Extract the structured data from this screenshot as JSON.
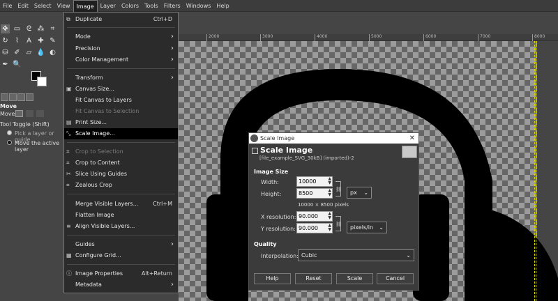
{
  "menubar": {
    "items": [
      "File",
      "Edit",
      "Select",
      "View",
      "Image",
      "Layer",
      "Colors",
      "Tools",
      "Filters",
      "Windows",
      "Help"
    ],
    "active": "Image"
  },
  "tool_options": {
    "title": "Move",
    "move_label": "Move:",
    "toggle_label": "Tool Toggle  (Shift)",
    "radio1": "Pick a layer or guide",
    "radio2": "Move the active layer"
  },
  "ruler": {
    "ticks": [
      "2000",
      "3000",
      "4000",
      "5000",
      "6000",
      "7000",
      "8000"
    ]
  },
  "image_menu": {
    "items": [
      {
        "label": "Duplicate",
        "shortcut": "Ctrl+D",
        "icon": "duplicate-icon"
      },
      {
        "label": "Mode",
        "submenu": true
      },
      {
        "label": "Precision",
        "submenu": true
      },
      {
        "label": "Color Management",
        "submenu": true
      },
      {
        "label": "Transform",
        "submenu": true
      },
      {
        "label": "Canvas Size...",
        "icon": "canvas-size-icon"
      },
      {
        "label": "Fit Canvas to Layers"
      },
      {
        "label": "Fit Canvas to Selection",
        "disabled": true
      },
      {
        "label": "Print Size...",
        "icon": "print-size-icon"
      },
      {
        "label": "Scale Image...",
        "icon": "scale-image-icon",
        "highlighted": true
      },
      {
        "label": "Crop to Selection",
        "disabled": true,
        "icon": "crop-icon"
      },
      {
        "label": "Crop to Content",
        "icon": "crop-icon"
      },
      {
        "label": "Slice Using Guides",
        "icon": "slice-icon"
      },
      {
        "label": "Zealous Crop",
        "icon": "zealous-crop-icon"
      },
      {
        "label": "Merge Visible Layers...",
        "shortcut": "Ctrl+M"
      },
      {
        "label": "Flatten Image"
      },
      {
        "label": "Align Visible Layers...",
        "icon": "align-icon"
      },
      {
        "label": "Guides",
        "submenu": true
      },
      {
        "label": "Configure Grid...",
        "icon": "grid-icon"
      },
      {
        "label": "Image Properties",
        "shortcut": "Alt+Return",
        "icon": "info-icon"
      },
      {
        "label": "Metadata",
        "submenu": true
      }
    ]
  },
  "dialog": {
    "window_title": "Scale Image",
    "heading": "Scale Image",
    "subtitle": "[file_example_SVG_30kB] (imported)-2",
    "image_size_label": "Image Size",
    "width_label": "Width:",
    "width_value": "10000",
    "height_label": "Height:",
    "height_value": "8500",
    "size_summary": "10000 × 8500 pixels",
    "unit": "px",
    "xres_label": "X resolution:",
    "xres_value": "90.000",
    "yres_label": "Y resolution:",
    "yres_value": "90.000",
    "res_unit": "pixels/in",
    "quality_label": "Quality",
    "interp_label": "Interpolation:",
    "interp_value": "Cubic",
    "buttons": {
      "help": "Help",
      "reset": "Reset",
      "scale": "Scale",
      "cancel": "Cancel"
    }
  }
}
